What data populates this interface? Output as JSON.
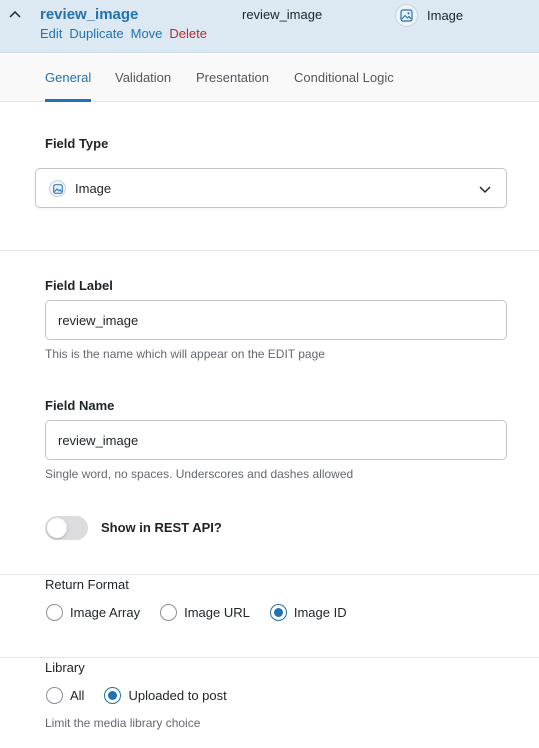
{
  "header": {
    "title": "review_image",
    "actions": {
      "edit": "Edit",
      "duplicate": "Duplicate",
      "move": "Move",
      "delete": "Delete"
    },
    "field_name": "review_image",
    "field_type": "Image"
  },
  "tabs": [
    "General",
    "Validation",
    "Presentation",
    "Conditional Logic"
  ],
  "active_tab": "General",
  "field_type": {
    "label": "Field Type",
    "value": "Image"
  },
  "field_label": {
    "label": "Field Label",
    "value": "review_image",
    "hint": "This is the name which will appear on the EDIT page"
  },
  "field_name": {
    "label": "Field Name",
    "value": "review_image",
    "hint": "Single word, no spaces. Underscores and dashes allowed"
  },
  "rest_api": {
    "label": "Show in REST API?",
    "enabled": false
  },
  "return_format": {
    "label": "Return Format",
    "options": [
      "Image Array",
      "Image URL",
      "Image ID"
    ],
    "selected": "Image ID"
  },
  "library": {
    "label": "Library",
    "options": [
      "All",
      "Uploaded to post"
    ],
    "selected": "Uploaded to post",
    "hint": "Limit the media library choice"
  },
  "colors": {
    "accent": "#2271b1",
    "delete": "#b32d2e",
    "header_bg": "#dce9f3"
  }
}
